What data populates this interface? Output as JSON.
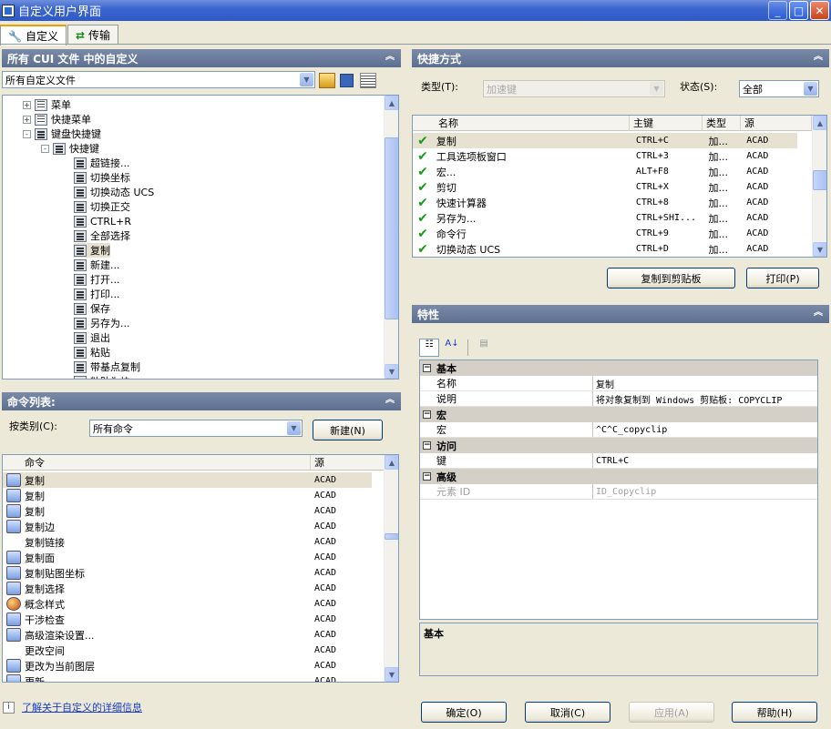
{
  "window": {
    "title": "自定义用户界面"
  },
  "tabs": [
    {
      "label": "自定义"
    },
    {
      "label": "传输"
    }
  ],
  "left_top": {
    "header": "所有 CUI 文件 中的自定义",
    "file_combo": "所有自定义文件",
    "tree": [
      {
        "label": "菜单",
        "level": 1,
        "expander": "+"
      },
      {
        "label": "快捷菜单",
        "level": 1,
        "expander": "+"
      },
      {
        "label": "键盘快捷键",
        "level": 1,
        "expander": "-"
      },
      {
        "label": "快捷键",
        "level": 2,
        "expander": "-"
      },
      {
        "label": "超链接...",
        "level": 3
      },
      {
        "label": "切换坐标",
        "level": 3
      },
      {
        "label": "切换动态 UCS",
        "level": 3
      },
      {
        "label": "切换正交",
        "level": 3
      },
      {
        "label": "CTRL+R",
        "level": 3
      },
      {
        "label": "全部选择",
        "level": 3
      },
      {
        "label": "复制",
        "level": 3,
        "selected": true
      },
      {
        "label": "新建...",
        "level": 3
      },
      {
        "label": "打开...",
        "level": 3
      },
      {
        "label": "打印...",
        "level": 3
      },
      {
        "label": "保存",
        "level": 3
      },
      {
        "label": "另存为...",
        "level": 3
      },
      {
        "label": "退出",
        "level": 3
      },
      {
        "label": "粘贴",
        "level": 3
      },
      {
        "label": "带基点复制",
        "level": 3
      },
      {
        "label": "粘贴为块",
        "level": 3
      }
    ]
  },
  "left_bottom": {
    "header": "命令列表:",
    "category_label": "按类别(C):",
    "category_value": "所有命令",
    "new_button": "新建(N)",
    "columns": [
      "命令",
      "源"
    ],
    "rows": [
      {
        "name": "复制",
        "source": "ACAD",
        "icon": "copy-icon",
        "selected": true
      },
      {
        "name": "复制",
        "source": "ACAD",
        "icon": "copy-objects-icon"
      },
      {
        "name": "复制",
        "source": "ACAD",
        "icon": "copy-objects-icon"
      },
      {
        "name": "复制边",
        "source": "ACAD",
        "icon": "copy-edge-icon"
      },
      {
        "name": "复制链接",
        "source": "ACAD",
        "icon": ""
      },
      {
        "name": "复制面",
        "source": "ACAD",
        "icon": "copy-face-icon"
      },
      {
        "name": "复制贴图坐标",
        "source": "ACAD",
        "icon": "copy-mapping-icon"
      },
      {
        "name": "复制选择",
        "source": "ACAD",
        "icon": "copy-objects-icon"
      },
      {
        "name": "概念样式",
        "source": "ACAD",
        "icon": "conceptual-style-icon"
      },
      {
        "name": "干涉检查",
        "source": "ACAD",
        "icon": "interference-icon"
      },
      {
        "name": "高级渲染设置...",
        "source": "ACAD",
        "icon": "render-settings-icon"
      },
      {
        "name": "更改空间",
        "source": "ACAD",
        "icon": ""
      },
      {
        "name": "更改为当前图层",
        "source": "ACAD",
        "icon": "change-layer-icon"
      },
      {
        "name": "更新",
        "source": "ACAD",
        "icon": "update-icon"
      }
    ]
  },
  "shortcuts": {
    "header": "快捷方式",
    "type_label": "类型(T):",
    "type_value": "加速键",
    "status_label": "状态(S):",
    "status_value": "全部",
    "columns": [
      "名称",
      "主键",
      "类型",
      "源"
    ],
    "rows": [
      {
        "name": "复制",
        "key": "CTRL+C",
        "type": "加...",
        "source": "ACAD",
        "selected": true
      },
      {
        "name": "工具选项板窗口",
        "key": "CTRL+3",
        "type": "加...",
        "source": "ACAD"
      },
      {
        "name": "宏...",
        "key": "ALT+F8",
        "type": "加...",
        "source": "ACAD"
      },
      {
        "name": "剪切",
        "key": "CTRL+X",
        "type": "加...",
        "source": "ACAD"
      },
      {
        "name": "快速计算器",
        "key": "CTRL+8",
        "type": "加...",
        "source": "ACAD"
      },
      {
        "name": "另存为...",
        "key": "CTRL+SHI...",
        "type": "加...",
        "source": "ACAD"
      },
      {
        "name": "命令行",
        "key": "CTRL+9",
        "type": "加...",
        "source": "ACAD"
      },
      {
        "name": "切换动态 UCS",
        "key": "CTRL+D",
        "type": "加...",
        "source": "ACAD"
      }
    ],
    "copy_button": "复制到剪贴板",
    "print_button": "打印(P)"
  },
  "properties": {
    "header": "特性",
    "groups": [
      {
        "name": "基本",
        "rows": [
          {
            "key": "名称",
            "value": "复制"
          },
          {
            "key": "说明",
            "value": "将对象复制到 Windows 剪贴板:  COPYCLIP"
          }
        ]
      },
      {
        "name": "宏",
        "rows": [
          {
            "key": "宏",
            "value": "^C^C_copyclip"
          }
        ]
      },
      {
        "name": "访问",
        "rows": [
          {
            "key": "键",
            "value": "CTRL+C"
          }
        ]
      },
      {
        "name": "高级",
        "rows": [
          {
            "key": "元素 ID",
            "value": "ID_Copyclip",
            "disabled": true
          }
        ]
      }
    ],
    "description_title": "基本"
  },
  "footer": {
    "info_link": "了解关于自定义的详细信息",
    "ok": "确定(O)",
    "cancel": "取消(C)",
    "apply": "应用(A)",
    "help": "帮助(H)"
  }
}
